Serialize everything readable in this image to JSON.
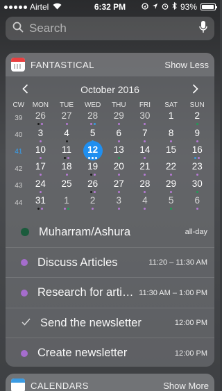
{
  "status": {
    "carrier": "Airtel",
    "time": "6:32 PM",
    "battery": "93%",
    "battery_fraction": 0.93
  },
  "search": {
    "placeholder": "Search"
  },
  "widget": {
    "app_name": "FANTASTICAL",
    "action": "Show Less",
    "month": "October 2016",
    "cw_label": "CW",
    "weekdays": [
      "MON",
      "TUE",
      "WED",
      "THU",
      "FRI",
      "SAT",
      "SUN"
    ],
    "weeks": [
      {
        "cw": "39",
        "days": [
          {
            "n": "26",
            "other": true,
            "dots": [
              "c-black",
              "c-purple"
            ]
          },
          {
            "n": "27",
            "other": true,
            "dots": [
              "c-purple"
            ]
          },
          {
            "n": "28",
            "other": true,
            "dots": [
              "c-purple",
              "c-blue"
            ]
          },
          {
            "n": "29",
            "other": true,
            "dots": [
              "c-purple"
            ]
          },
          {
            "n": "30",
            "other": true,
            "dots": [
              "c-purple"
            ]
          },
          {
            "n": "1",
            "dots": []
          },
          {
            "n": "2",
            "dots": [
              "c-green"
            ]
          }
        ]
      },
      {
        "cw": "40",
        "days": [
          {
            "n": "3",
            "dots": [
              "c-purple"
            ]
          },
          {
            "n": "4",
            "dots": [
              "c-black"
            ]
          },
          {
            "n": "5",
            "dots": [
              "c-blue"
            ]
          },
          {
            "n": "6",
            "dots": [
              "c-purple"
            ]
          },
          {
            "n": "7",
            "dots": [
              "c-purple"
            ]
          },
          {
            "n": "8",
            "dots": [
              "c-purple"
            ]
          },
          {
            "n": "9",
            "dots": [
              "c-purple"
            ]
          }
        ]
      },
      {
        "cw": "41",
        "current": true,
        "days": [
          {
            "n": "10",
            "dots": [
              "c-purple"
            ]
          },
          {
            "n": "11",
            "dots": [
              "c-black",
              "c-purple"
            ]
          },
          {
            "n": "12",
            "today": true,
            "dots": [
              "c-blue",
              "c-blue",
              "c-blue"
            ]
          },
          {
            "n": "13",
            "dots": [
              "c-green"
            ]
          },
          {
            "n": "14",
            "dots": [
              "c-purple"
            ]
          },
          {
            "n": "15",
            "dots": []
          },
          {
            "n": "16",
            "dots": [
              "c-blue",
              "c-purple"
            ]
          }
        ]
      },
      {
        "cw": "42",
        "days": [
          {
            "n": "17",
            "dots": [
              "c-purple"
            ]
          },
          {
            "n": "18",
            "dots": [
              "c-purple"
            ]
          },
          {
            "n": "19",
            "dots": [
              "c-black",
              "c-purple"
            ]
          },
          {
            "n": "20",
            "dots": [
              "c-purple"
            ]
          },
          {
            "n": "21",
            "dots": [
              "c-purple"
            ]
          },
          {
            "n": "22",
            "dots": [
              "c-purple"
            ]
          },
          {
            "n": "23",
            "dots": [
              "c-purple"
            ]
          }
        ]
      },
      {
        "cw": "43",
        "days": [
          {
            "n": "24",
            "dots": [
              "c-purple"
            ]
          },
          {
            "n": "25",
            "dots": []
          },
          {
            "n": "26",
            "dots": [
              "c-black",
              "c-purple"
            ]
          },
          {
            "n": "27",
            "dots": [
              "c-purple"
            ]
          },
          {
            "n": "28",
            "dots": [
              "c-purple"
            ]
          },
          {
            "n": "29",
            "dots": [
              "c-purple"
            ]
          },
          {
            "n": "30",
            "dots": [
              "c-green"
            ]
          }
        ]
      },
      {
        "cw": "44",
        "days": [
          {
            "n": "31",
            "dots": [
              "c-black",
              "c-purple"
            ]
          },
          {
            "n": "1",
            "other": true,
            "dots": [
              "c-purple",
              "c-green"
            ]
          },
          {
            "n": "2",
            "other": true,
            "dots": [
              "c-purple"
            ]
          },
          {
            "n": "3",
            "other": true,
            "dots": [
              "c-purple"
            ]
          },
          {
            "n": "4",
            "other": true,
            "dots": [
              "c-purple"
            ]
          },
          {
            "n": "5",
            "other": true,
            "dots": [
              "c-green"
            ]
          },
          {
            "n": "6",
            "other": true,
            "dots": [
              "c-purple"
            ]
          }
        ]
      }
    ],
    "events": [
      {
        "marker": "green",
        "title": "Muharram/Ashura",
        "time": "all-day"
      },
      {
        "marker": "purple",
        "title": "Discuss Articles",
        "time": "11:20 – 11:30 AM"
      },
      {
        "marker": "purple",
        "title": "Research for articles",
        "time": "11:30 AM – 1:00 PM"
      },
      {
        "marker": "check",
        "title": "Send the newsletter",
        "time": "12:00 PM"
      },
      {
        "marker": "purple",
        "title": "Create newsletter",
        "time": "12:00 PM"
      }
    ]
  },
  "widget2": {
    "app_name": "CALENDARS",
    "action": "Show More"
  }
}
